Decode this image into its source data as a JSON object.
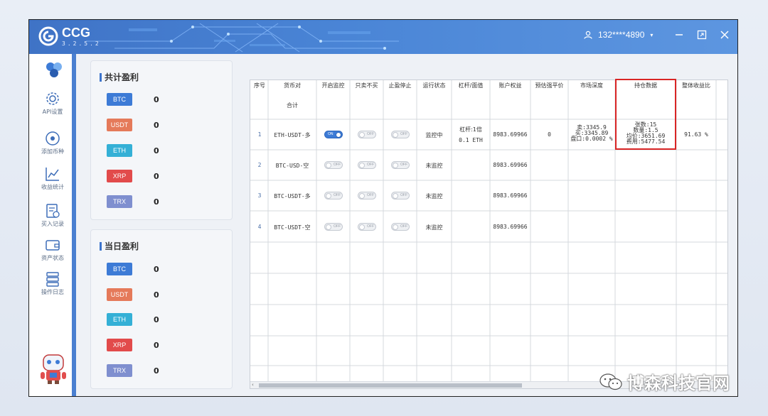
{
  "app": {
    "name": "CCG",
    "version": "3.2.5.2"
  },
  "user": {
    "phone": "132****4890"
  },
  "sidebar": {
    "items": [
      {
        "label": "API设置",
        "icon": "gear-icon"
      },
      {
        "label": "添加币种",
        "icon": "target-icon"
      },
      {
        "label": "收益统计",
        "icon": "chart-icon"
      },
      {
        "label": "买入记录",
        "icon": "record-icon"
      },
      {
        "label": "资产状态",
        "icon": "wallet-icon"
      },
      {
        "label": "操作日志",
        "icon": "log-icon"
      }
    ]
  },
  "total_profit": {
    "title": "共计盈利",
    "coins": [
      {
        "name": "BTC",
        "value": "0",
        "color": "#3d7bd6"
      },
      {
        "name": "USDT",
        "value": "0",
        "color": "#e57a5a"
      },
      {
        "name": "ETH",
        "value": "0",
        "color": "#34b0d6"
      },
      {
        "name": "XRP",
        "value": "0",
        "color": "#e24b4b"
      },
      {
        "name": "TRX",
        "value": "0",
        "color": "#7f8fcf"
      }
    ]
  },
  "daily_profit": {
    "title": "当日盈利",
    "coins": [
      {
        "name": "BTC",
        "value": "0",
        "color": "#3d7bd6"
      },
      {
        "name": "USDT",
        "value": "0",
        "color": "#e57a5a"
      },
      {
        "name": "ETH",
        "value": "0",
        "color": "#34b0d6"
      },
      {
        "name": "XRP",
        "value": "0",
        "color": "#e24b4b"
      },
      {
        "name": "TRX",
        "value": "0",
        "color": "#7f8fcf"
      }
    ]
  },
  "table": {
    "headers": [
      "序号",
      "货币对",
      "开启监控",
      "只卖不买",
      "止盈停止",
      "运行状态",
      "杠杆/面值",
      "账户权益",
      "预估强平价",
      "市场深度",
      "持仓数据",
      "整体收益比"
    ],
    "total_label": "合计",
    "rows": [
      {
        "index": "1",
        "pair": "ETH-USDT-多",
        "monitor": "ON",
        "sell_only": "OFF",
        "stop_profit": "OFF",
        "status": "监控中",
        "leverage": "杠杆:1倍",
        "face_value": "0.1 ETH",
        "equity": "8983.69966",
        "liq_price": "0",
        "depth": [
          "卖:3345.9",
          "买:3345.89",
          "盘口:0.0002 %"
        ],
        "position": [
          "张数:15",
          "数量:1.5",
          "均价:3651.69",
          "费用:5477.54"
        ],
        "ratio": "91.63 %"
      },
      {
        "index": "2",
        "pair": "BTC-USD-空",
        "monitor": "OFF",
        "sell_only": "OFF",
        "stop_profit": "OFF",
        "status": "未监控",
        "equity": "8983.69966"
      },
      {
        "index": "3",
        "pair": "BTC-USDT-多",
        "monitor": "OFF",
        "sell_only": "OFF",
        "stop_profit": "OFF",
        "status": "未监控",
        "equity": "8983.69966"
      },
      {
        "index": "4",
        "pair": "BTC-USDT-空",
        "monitor": "OFF",
        "sell_only": "OFF",
        "stop_profit": "OFF",
        "status": "未监控",
        "equity": "8983.69966"
      }
    ]
  },
  "watermark": "博森科技官网",
  "colors": {
    "accent": "#3d7bd6",
    "highlight": "#d92525"
  }
}
